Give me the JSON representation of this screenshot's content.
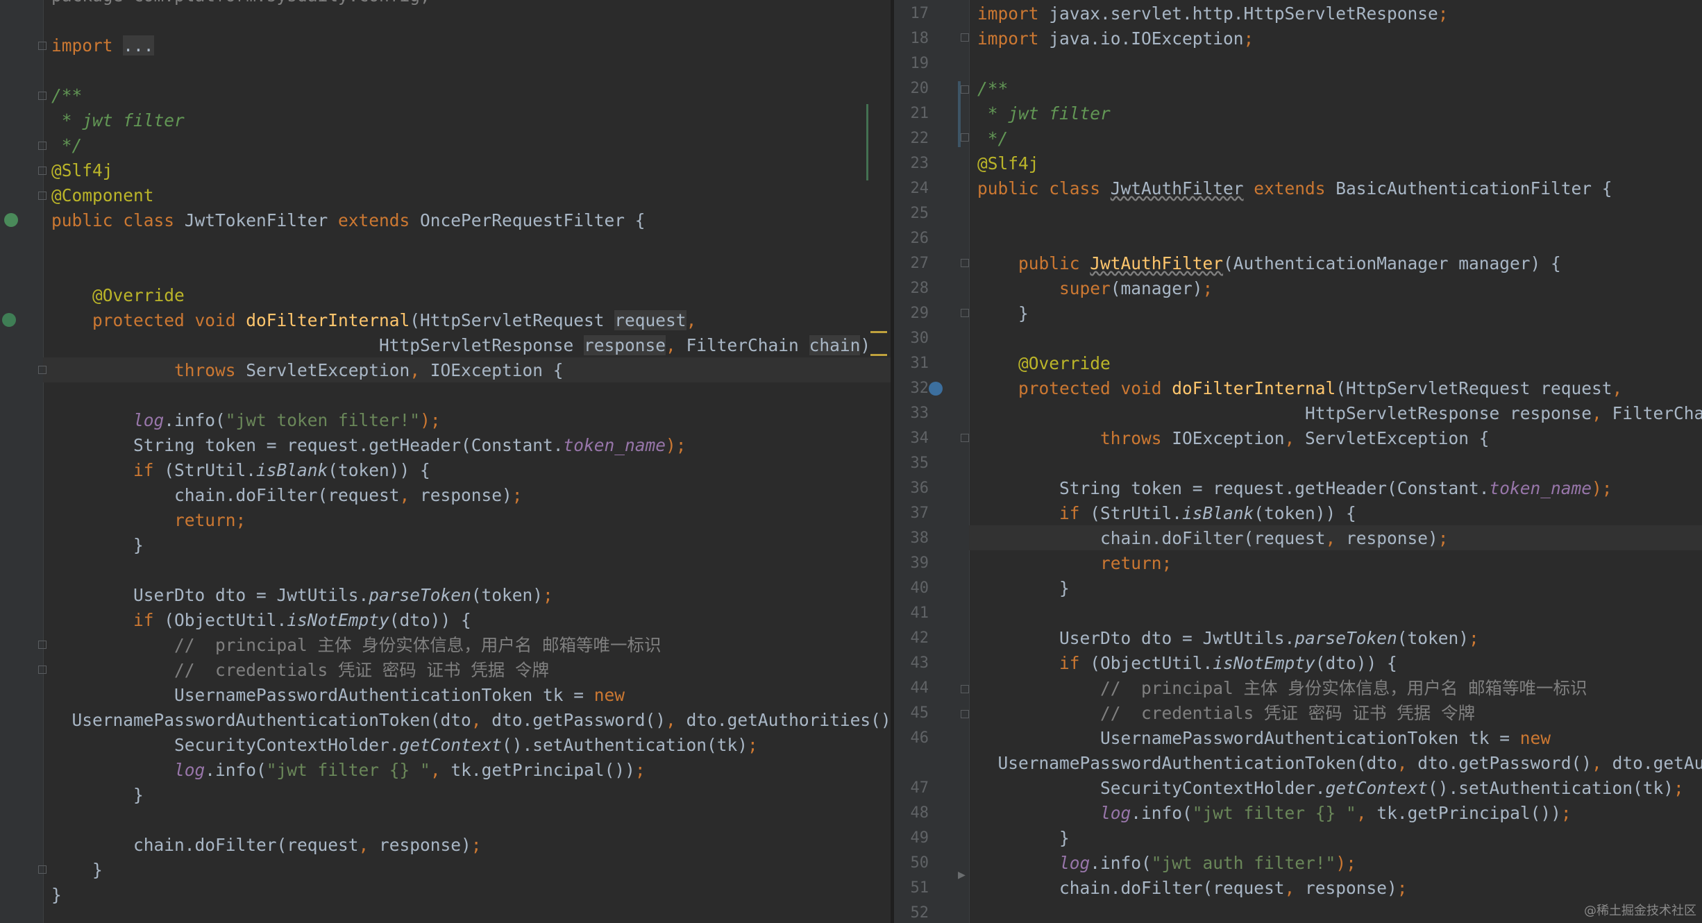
{
  "left": {
    "lines": [
      {
        "tokens": [
          {
            "t": "package com.platform.sysdaily.config;",
            "c": "dim"
          }
        ]
      },
      {
        "tokens": []
      },
      {
        "tokens": [
          {
            "t": "import ",
            "c": "kw"
          },
          {
            "t": "...",
            "c": "box"
          }
        ]
      },
      {
        "tokens": []
      },
      {
        "tokens": [
          {
            "t": "/**",
            "c": "cmt"
          }
        ]
      },
      {
        "tokens": [
          {
            "t": " * jwt filter",
            "c": "cmt"
          }
        ]
      },
      {
        "tokens": [
          {
            "t": " */",
            "c": "cmt"
          }
        ]
      },
      {
        "tokens": [
          {
            "t": "@Slf4j",
            "c": "ann"
          }
        ]
      },
      {
        "tokens": [
          {
            "t": "@Component",
            "c": "ann"
          }
        ]
      },
      {
        "tokens": [
          {
            "t": "public class ",
            "c": "kw"
          },
          {
            "t": "JwtTokenFilter ",
            "c": ""
          },
          {
            "t": "extends ",
            "c": "kw"
          },
          {
            "t": "OncePerRequestFilter {",
            "c": ""
          }
        ]
      },
      {
        "tokens": []
      },
      {
        "tokens": []
      },
      {
        "tokens": [
          {
            "t": "    @Override",
            "c": "ann"
          }
        ]
      },
      {
        "tokens": [
          {
            "t": "    protected void ",
            "c": "kw"
          },
          {
            "t": "doFilterInternal",
            "c": "mth"
          },
          {
            "t": "(HttpServletRequest ",
            "c": ""
          },
          {
            "t": "request",
            "c": "box"
          },
          {
            "t": ",",
            "c": "kw"
          }
        ]
      },
      {
        "tokens": [
          {
            "t": "                                HttpServletResponse ",
            "c": ""
          },
          {
            "t": "response",
            "c": "box"
          },
          {
            "t": ", ",
            "c": "kw"
          },
          {
            "t": "FilterChain ",
            "c": ""
          },
          {
            "t": "chain",
            "c": "box"
          },
          {
            "t": ")",
            "c": ""
          }
        ]
      },
      {
        "tokens": [
          {
            "t": "            throws ",
            "c": "kw"
          },
          {
            "t": "ServletException",
            "c": ""
          },
          {
            "t": ", ",
            "c": "kw"
          },
          {
            "t": "IOException {",
            "c": ""
          }
        ]
      },
      {
        "tokens": []
      },
      {
        "tokens": [
          {
            "t": "        ",
            "c": ""
          },
          {
            "t": "log",
            "c": "log"
          },
          {
            "t": ".info(",
            "c": ""
          },
          {
            "t": "\"jwt token filter!\"",
            "c": "str"
          },
          {
            "t": ");",
            "c": "kw"
          }
        ]
      },
      {
        "tokens": [
          {
            "t": "        String token = request.getHeader(Constant.",
            "c": ""
          },
          {
            "t": "token_name",
            "c": "field"
          },
          {
            "t": ");",
            "c": "kw"
          }
        ]
      },
      {
        "tokens": [
          {
            "t": "        if ",
            "c": "kw"
          },
          {
            "t": "(StrUtil.",
            "c": ""
          },
          {
            "t": "isBlank",
            "c": "it"
          },
          {
            "t": "(token)) {",
            "c": ""
          }
        ]
      },
      {
        "tokens": [
          {
            "t": "            chain.doFilter(request",
            "c": ""
          },
          {
            "t": ", ",
            "c": "kw"
          },
          {
            "t": "response)",
            "c": ""
          },
          {
            "t": ";",
            "c": "kw"
          }
        ]
      },
      {
        "tokens": [
          {
            "t": "            return;",
            "c": "kw"
          }
        ]
      },
      {
        "tokens": [
          {
            "t": "        }",
            "c": ""
          }
        ]
      },
      {
        "tokens": []
      },
      {
        "tokens": [
          {
            "t": "        UserDto dto = JwtUtils.",
            "c": ""
          },
          {
            "t": "parseToken",
            "c": "it"
          },
          {
            "t": "(token)",
            "c": ""
          },
          {
            "t": ";",
            "c": "kw"
          }
        ]
      },
      {
        "tokens": [
          {
            "t": "        if ",
            "c": "kw"
          },
          {
            "t": "(ObjectUtil.",
            "c": ""
          },
          {
            "t": "isNotEmpty",
            "c": "it"
          },
          {
            "t": "(dto)) {",
            "c": ""
          }
        ]
      },
      {
        "tokens": [
          {
            "t": "            //  principal 主体 身份实体信息，用户名 邮箱等唯一标识",
            "c": "lc"
          }
        ]
      },
      {
        "tokens": [
          {
            "t": "            //  credentials 凭证 密码 证书 凭据 令牌",
            "c": "lc"
          }
        ]
      },
      {
        "tokens": [
          {
            "t": "            UsernamePasswordAuthenticationToken tk = ",
            "c": ""
          },
          {
            "t": "new",
            "c": "kw"
          }
        ]
      },
      {
        "tokens": [
          {
            "t": "  UsernamePasswordAuthenticationToken(dto",
            "c": ""
          },
          {
            "t": ", ",
            "c": "kw"
          },
          {
            "t": "dto.getPassword()",
            "c": ""
          },
          {
            "t": ", ",
            "c": "kw"
          },
          {
            "t": "dto.getAuthorities())",
            "c": ""
          },
          {
            "t": ";",
            "c": "kw"
          }
        ]
      },
      {
        "tokens": [
          {
            "t": "            SecurityContextHolder.",
            "c": ""
          },
          {
            "t": "getContext",
            "c": "it"
          },
          {
            "t": "().setAuthentication(tk)",
            "c": ""
          },
          {
            "t": ";",
            "c": "kw"
          }
        ]
      },
      {
        "tokens": [
          {
            "t": "            ",
            "c": ""
          },
          {
            "t": "log",
            "c": "log"
          },
          {
            "t": ".info(",
            "c": ""
          },
          {
            "t": "\"jwt filter {} \"",
            "c": "str"
          },
          {
            "t": ", ",
            "c": "kw"
          },
          {
            "t": "tk.getPrincipal())",
            "c": ""
          },
          {
            "t": ";",
            "c": "kw"
          }
        ]
      },
      {
        "tokens": [
          {
            "t": "        }",
            "c": ""
          }
        ]
      },
      {
        "tokens": []
      },
      {
        "tokens": [
          {
            "t": "        chain.doFilter(request",
            "c": ""
          },
          {
            "t": ", ",
            "c": "kw"
          },
          {
            "t": "response)",
            "c": ""
          },
          {
            "t": ";",
            "c": "kw"
          }
        ]
      },
      {
        "tokens": [
          {
            "t": "    }",
            "c": ""
          }
        ]
      },
      {
        "tokens": [
          {
            "t": "}",
            "c": ""
          }
        ]
      }
    ]
  },
  "right": {
    "lines": [
      {
        "num": "17",
        "tokens": [
          {
            "t": "import ",
            "c": "kw"
          },
          {
            "t": "javax.servlet.http.HttpServletResponse",
            "c": ""
          },
          {
            "t": ";",
            "c": "kw"
          }
        ]
      },
      {
        "num": "18",
        "tokens": [
          {
            "t": "import ",
            "c": "kw"
          },
          {
            "t": "java.io.IOException",
            "c": ""
          },
          {
            "t": ";",
            "c": "kw"
          }
        ]
      },
      {
        "num": "19",
        "tokens": []
      },
      {
        "num": "20",
        "tokens": [
          {
            "t": "/**",
            "c": "cmt"
          }
        ]
      },
      {
        "num": "21",
        "tokens": [
          {
            "t": " * jwt filter",
            "c": "cmt"
          }
        ]
      },
      {
        "num": "22",
        "tokens": [
          {
            "t": " */",
            "c": "cmt"
          }
        ]
      },
      {
        "num": "23",
        "tokens": [
          {
            "t": "@Slf4j",
            "c": "ann"
          }
        ]
      },
      {
        "num": "24",
        "tokens": [
          {
            "t": "public class ",
            "c": "kw"
          },
          {
            "t": "JwtAuthFilter",
            "c": "sq"
          },
          {
            "t": " extends ",
            "c": "kw"
          },
          {
            "t": "BasicAuthenticationFilter {",
            "c": ""
          }
        ]
      },
      {
        "num": "25",
        "tokens": []
      },
      {
        "num": "26",
        "tokens": []
      },
      {
        "num": "27",
        "tokens": [
          {
            "t": "    public ",
            "c": "kw"
          },
          {
            "t": "JwtAuthFilter",
            "c": "sqm"
          },
          {
            "t": "(AuthenticationManager manager) {",
            "c": ""
          }
        ]
      },
      {
        "num": "28",
        "tokens": [
          {
            "t": "        super",
            "c": "kw"
          },
          {
            "t": "(manager)",
            "c": ""
          },
          {
            "t": ";",
            "c": "kw"
          }
        ]
      },
      {
        "num": "29",
        "tokens": [
          {
            "t": "    }",
            "c": ""
          }
        ]
      },
      {
        "num": "30",
        "tokens": []
      },
      {
        "num": "31",
        "tokens": [
          {
            "t": "    @Override",
            "c": "ann"
          }
        ]
      },
      {
        "num": "32",
        "tokens": [
          {
            "t": "    protected void ",
            "c": "kw"
          },
          {
            "t": "doFilterInternal",
            "c": "mth"
          },
          {
            "t": "(HttpServletRequest request",
            "c": ""
          },
          {
            "t": ",",
            "c": "kw"
          }
        ]
      },
      {
        "num": "33",
        "tokens": [
          {
            "t": "                                HttpServletResponse response",
            "c": ""
          },
          {
            "t": ", ",
            "c": "kw"
          },
          {
            "t": "FilterCha",
            "c": ""
          }
        ]
      },
      {
        "num": "34",
        "tokens": [
          {
            "t": "            throws ",
            "c": "kw"
          },
          {
            "t": "IOException",
            "c": ""
          },
          {
            "t": ", ",
            "c": "kw"
          },
          {
            "t": "ServletException {",
            "c": ""
          }
        ]
      },
      {
        "num": "35",
        "tokens": []
      },
      {
        "num": "36",
        "tokens": [
          {
            "t": "        String token = request.getHeader(Constant.",
            "c": ""
          },
          {
            "t": "token_name",
            "c": "field"
          },
          {
            "t": ");",
            "c": "kw"
          }
        ]
      },
      {
        "num": "37",
        "tokens": [
          {
            "t": "        if ",
            "c": "kw"
          },
          {
            "t": "(StrUtil.",
            "c": ""
          },
          {
            "t": "isBlank",
            "c": "it"
          },
          {
            "t": "(token)) {",
            "c": ""
          }
        ]
      },
      {
        "num": "38",
        "tokens": [
          {
            "t": "            chain.doFilter(request",
            "c": ""
          },
          {
            "t": ", ",
            "c": "kw"
          },
          {
            "t": "response)",
            "c": ""
          },
          {
            "t": ";",
            "c": "kw"
          }
        ]
      },
      {
        "num": "39",
        "tokens": [
          {
            "t": "            return;",
            "c": "kw"
          }
        ]
      },
      {
        "num": "40",
        "tokens": [
          {
            "t": "        }",
            "c": ""
          }
        ]
      },
      {
        "num": "41",
        "tokens": []
      },
      {
        "num": "42",
        "tokens": [
          {
            "t": "        UserDto dto = JwtUtils.",
            "c": ""
          },
          {
            "t": "parseToken",
            "c": "it"
          },
          {
            "t": "(token)",
            "c": ""
          },
          {
            "t": ";",
            "c": "kw"
          }
        ]
      },
      {
        "num": "43",
        "tokens": [
          {
            "t": "        if ",
            "c": "kw"
          },
          {
            "t": "(ObjectUtil.",
            "c": ""
          },
          {
            "t": "isNotEmpty",
            "c": "it"
          },
          {
            "t": "(dto)) {",
            "c": ""
          }
        ]
      },
      {
        "num": "44",
        "tokens": [
          {
            "t": "            //  principal 主体 身份实体信息，用户名 邮箱等唯一标识",
            "c": "lc"
          }
        ]
      },
      {
        "num": "45",
        "tokens": [
          {
            "t": "            //  credentials 凭证 密码 证书 凭据 令牌",
            "c": "lc"
          }
        ]
      },
      {
        "num": "46",
        "tokens": [
          {
            "t": "            UsernamePasswordAuthenticationToken tk = ",
            "c": ""
          },
          {
            "t": "new",
            "c": "kw"
          }
        ]
      },
      {
        "num": "",
        "tokens": [
          {
            "t": "  UsernamePasswordAuthenticationToken(dto",
            "c": ""
          },
          {
            "t": ", ",
            "c": "kw"
          },
          {
            "t": "dto.getPassword()",
            "c": ""
          },
          {
            "t": ", ",
            "c": "kw"
          },
          {
            "t": "dto.getAuthor",
            "c": ""
          }
        ]
      },
      {
        "num": "47",
        "tokens": [
          {
            "t": "            SecurityContextHolder.",
            "c": ""
          },
          {
            "t": "getContext",
            "c": "it"
          },
          {
            "t": "().setAuthentication(tk)",
            "c": ""
          },
          {
            "t": ";",
            "c": "kw"
          }
        ]
      },
      {
        "num": "48",
        "tokens": [
          {
            "t": "            ",
            "c": ""
          },
          {
            "t": "log",
            "c": "log"
          },
          {
            "t": ".info(",
            "c": ""
          },
          {
            "t": "\"jwt filter {} \"",
            "c": "str"
          },
          {
            "t": ", ",
            "c": "kw"
          },
          {
            "t": "tk.getPrincipal())",
            "c": ""
          },
          {
            "t": ";",
            "c": "kw"
          }
        ]
      },
      {
        "num": "49",
        "tokens": [
          {
            "t": "        }",
            "c": ""
          }
        ]
      },
      {
        "num": "50",
        "tokens": [
          {
            "t": "        ",
            "c": ""
          },
          {
            "t": "log",
            "c": "log"
          },
          {
            "t": ".info(",
            "c": ""
          },
          {
            "t": "\"jwt auth filter!\"",
            "c": "str"
          },
          {
            "t": ");",
            "c": "kw"
          }
        ]
      },
      {
        "num": "51",
        "tokens": [
          {
            "t": "        chain.doFilter(request",
            "c": ""
          },
          {
            "t": ", ",
            "c": "kw"
          },
          {
            "t": "response)",
            "c": ""
          },
          {
            "t": ";",
            "c": "kw"
          }
        ]
      },
      {
        "num": "52",
        "tokens": []
      }
    ]
  },
  "watermark": "@稀土掘金技术社区"
}
